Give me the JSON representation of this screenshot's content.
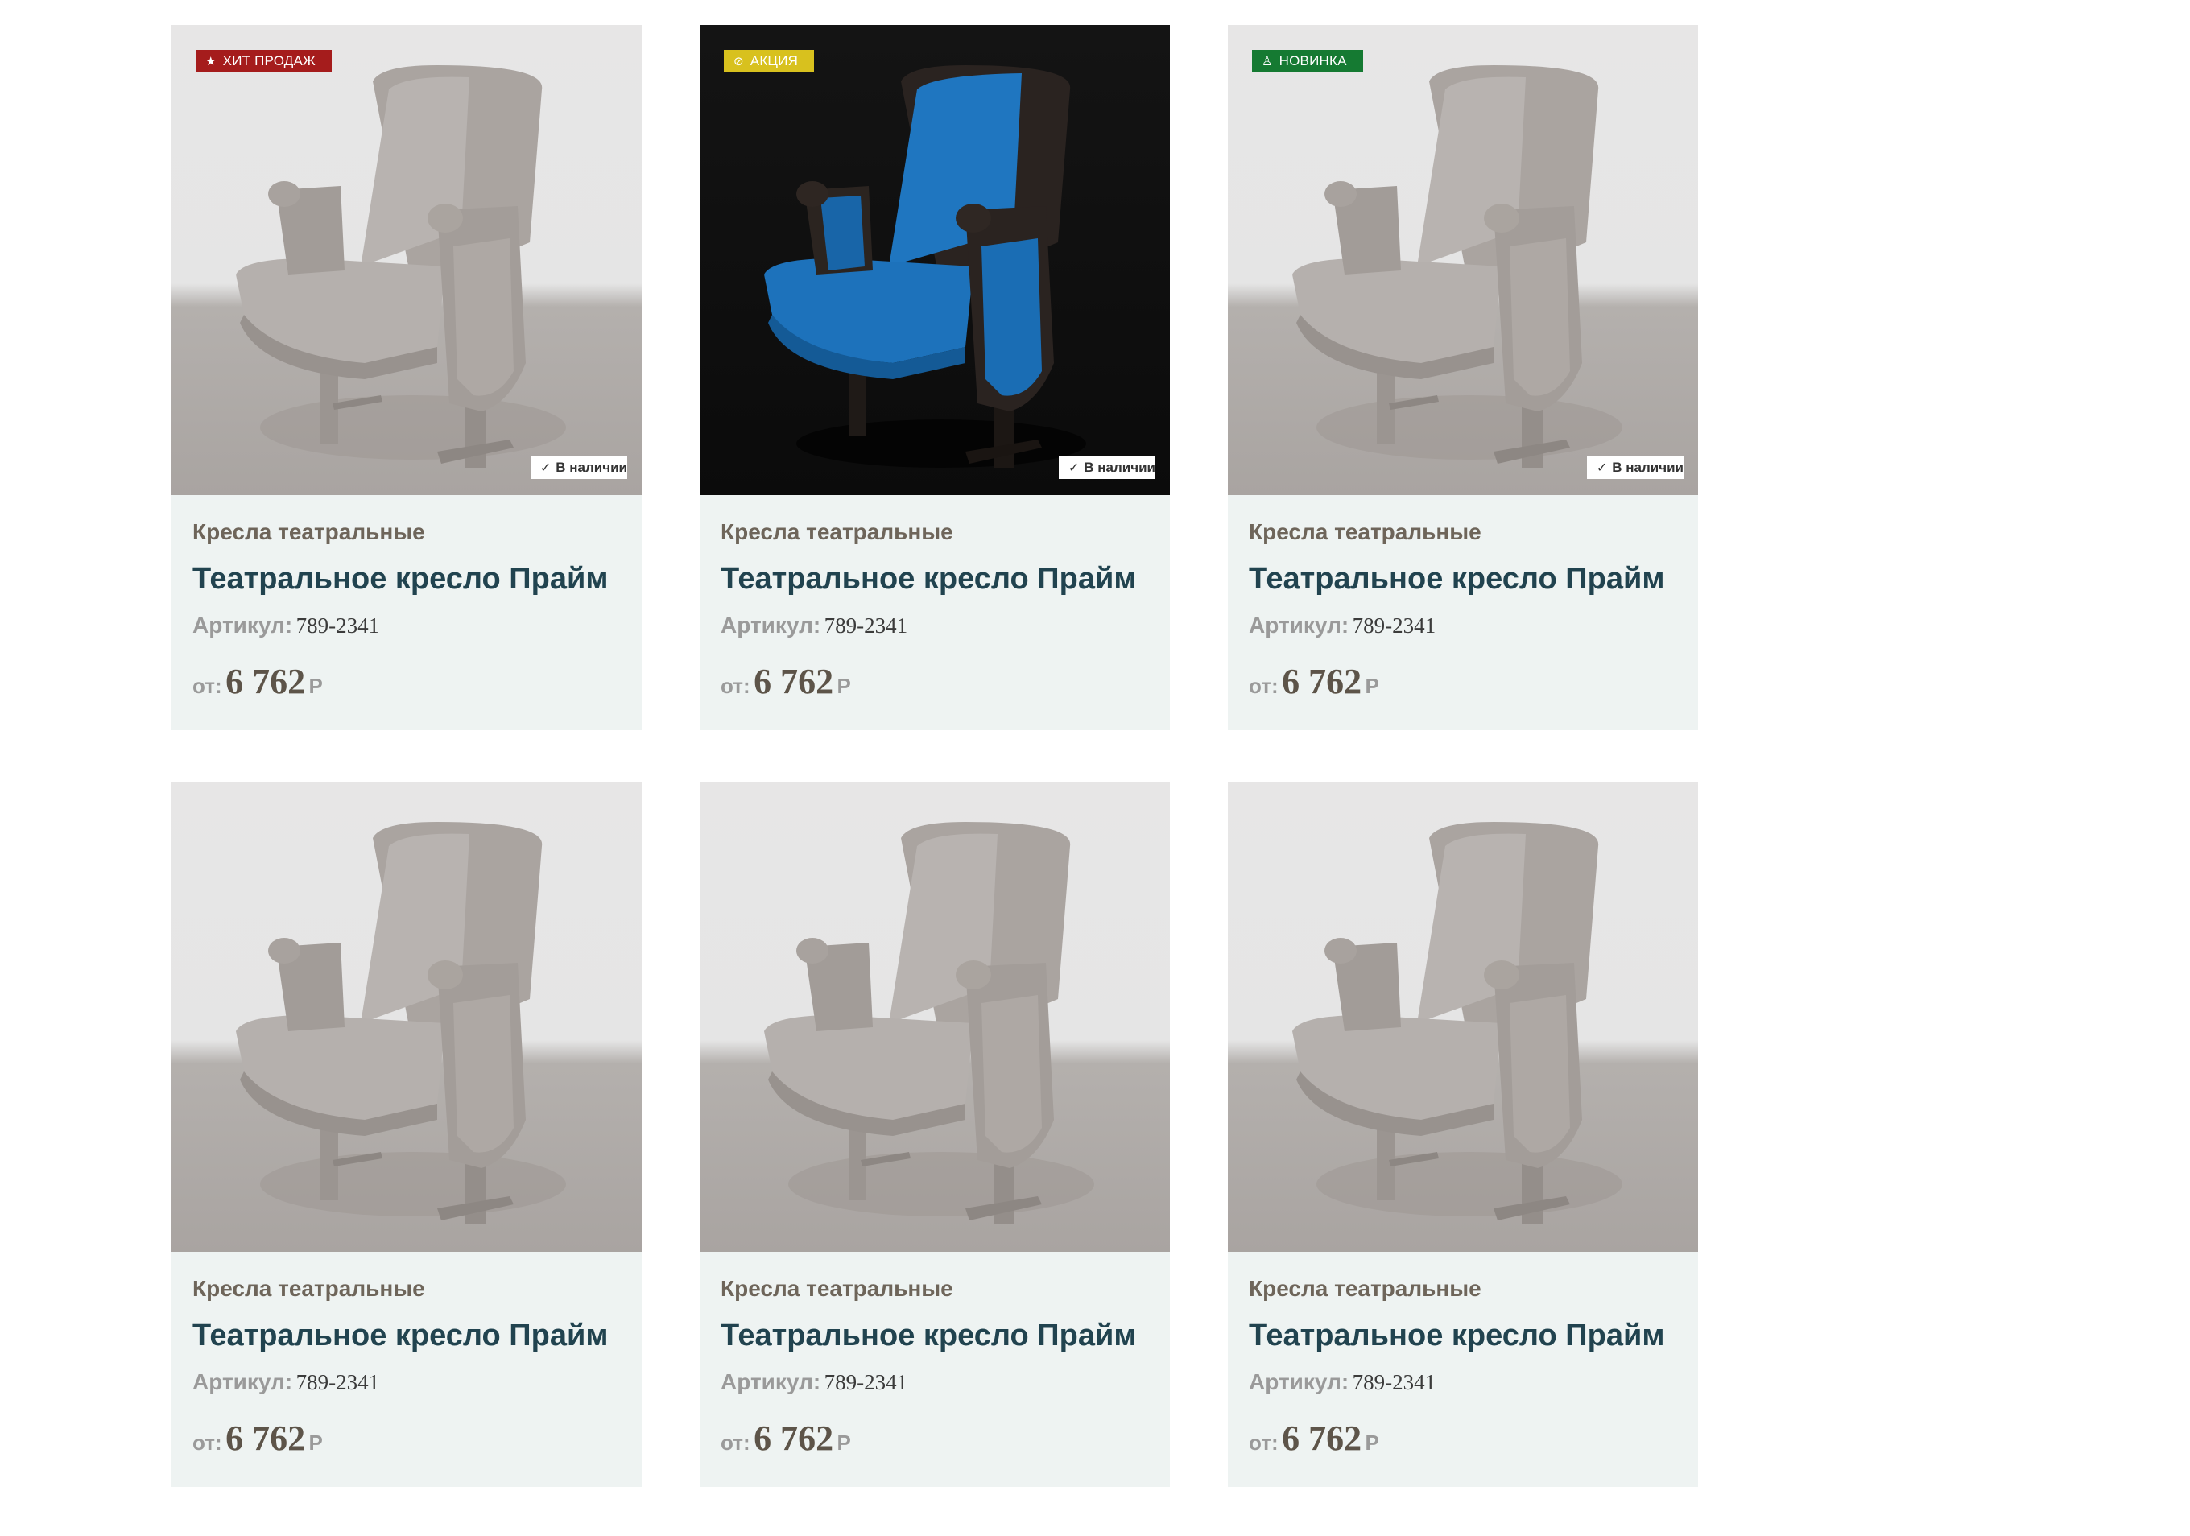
{
  "products": [
    {
      "category": "Кресла театральные",
      "title": "Театральное кресло Прайм",
      "sku_label": "Артикул:",
      "sku": "789-2341",
      "price_from": "от:",
      "price": "6 762",
      "currency": "Р",
      "badge": {
        "label": "ХИТ ПРОДАЖ",
        "icon": "star-icon",
        "color": "#a51c1c"
      },
      "stock": "В наличии",
      "variant": "light-grey"
    },
    {
      "category": "Кресла театральные",
      "title": "Театральное кресло Прайм",
      "sku_label": "Артикул:",
      "sku": "789-2341",
      "price_from": "от:",
      "price": "6 762",
      "currency": "Р",
      "badge": {
        "label": "АКЦИЯ",
        "icon": "percent-icon",
        "color": "#d8c11e"
      },
      "stock": "В наличии",
      "variant": "dark-blue"
    },
    {
      "category": "Кресла театральные",
      "title": "Театральное кресло Прайм",
      "sku_label": "Артикул:",
      "sku": "789-2341",
      "price_from": "от:",
      "price": "6 762",
      "currency": "Р",
      "badge": {
        "label": "НОВИНКА",
        "icon": "bell-icon",
        "color": "#157a32"
      },
      "stock": "В наличии",
      "variant": "light-grey"
    },
    {
      "category": "Кресла театральные",
      "title": "Театральное кресло Прайм",
      "sku_label": "Артикул:",
      "sku": "789-2341",
      "price_from": "от:",
      "price": "6 762",
      "currency": "Р",
      "badge": null,
      "stock": null,
      "variant": "light-grey"
    },
    {
      "category": "Кресла театральные",
      "title": "Театральное кресло Прайм",
      "sku_label": "Артикул:",
      "sku": "789-2341",
      "price_from": "от:",
      "price": "6 762",
      "currency": "Р",
      "badge": null,
      "stock": null,
      "variant": "light-grey"
    },
    {
      "category": "Кресла театральные",
      "title": "Театральное кресло Прайм",
      "sku_label": "Артикул:",
      "sku": "789-2341",
      "price_from": "от:",
      "price": "6 762",
      "currency": "Р",
      "badge": null,
      "stock": null,
      "variant": "light-grey"
    }
  ],
  "colors": {
    "card_bg": "#eef3f2",
    "title": "#21434f",
    "category": "#6e655a",
    "muted": "#9a9a9a",
    "price": "#5d5449"
  }
}
